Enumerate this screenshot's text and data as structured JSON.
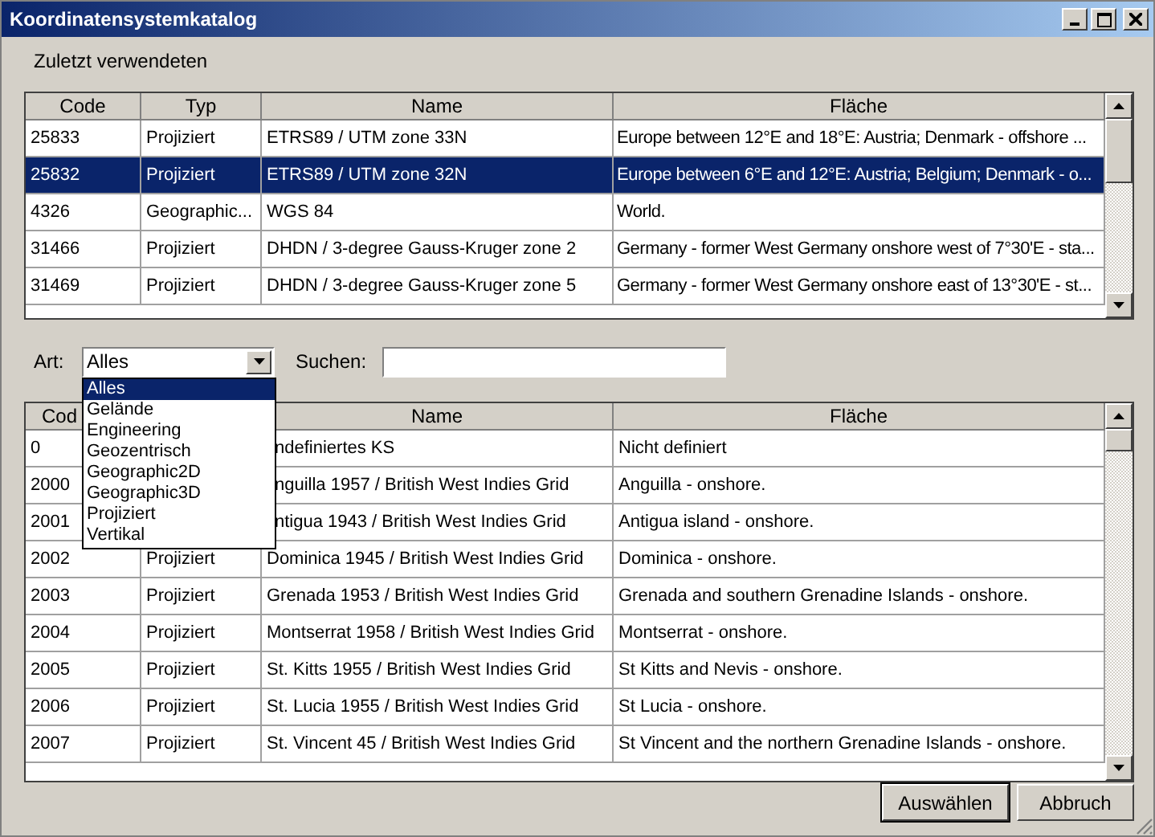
{
  "window": {
    "title": "Koordinatensystemkatalog"
  },
  "recent": {
    "label": "Zuletzt verwendeten",
    "columns": [
      "Code",
      "Typ",
      "Name",
      "Fläche"
    ],
    "rows": [
      {
        "code": "25833",
        "typ": "Projiziert",
        "name": "ETRS89 / UTM zone 33N",
        "flaeche": "Europe between 12°E and 18°E: Austria; Denmark - offshore ...",
        "selected": false
      },
      {
        "code": "25832",
        "typ": "Projiziert",
        "name": "ETRS89 / UTM zone 32N",
        "flaeche": "Europe between 6°E and 12°E: Austria; Belgium; Denmark - o...",
        "selected": true
      },
      {
        "code": "4326",
        "typ": "Geographic...",
        "name": "WGS 84",
        "flaeche": "World.",
        "selected": false
      },
      {
        "code": "31466",
        "typ": "Projiziert",
        "name": "DHDN / 3-degree Gauss-Kruger zone 2",
        "flaeche": "Germany - former West Germany onshore west of 7°30'E - sta...",
        "selected": false
      },
      {
        "code": "31469",
        "typ": "Projiziert",
        "name": "DHDN / 3-degree Gauss-Kruger zone 5",
        "flaeche": "Germany - former West Germany onshore east of 13°30'E - st...",
        "selected": false
      }
    ]
  },
  "filter": {
    "art_label": "Art:",
    "art_value": "Alles",
    "search_label": "Suchen:",
    "options": [
      {
        "label": "Alles",
        "selected": true
      },
      {
        "label": "Gelände",
        "selected": false
      },
      {
        "label": "Engineering",
        "selected": false
      },
      {
        "label": "Geozentrisch",
        "selected": false
      },
      {
        "label": "Geographic2D",
        "selected": false
      },
      {
        "label": "Geographic3D",
        "selected": false
      },
      {
        "label": "Projiziert",
        "selected": false
      },
      {
        "label": "Vertikal",
        "selected": false
      }
    ]
  },
  "catalog": {
    "columns": [
      "Cod",
      "Name",
      "Fläche"
    ],
    "rows": [
      {
        "code": "0",
        "name": "ndefiniertes KS",
        "flaeche": "Nicht definiert"
      },
      {
        "code": "2000",
        "name": "nguilla 1957 / British West Indies Grid",
        "flaeche": "Anguilla - onshore."
      },
      {
        "code": "2001",
        "name": "ntigua 1943 / British West Indies Grid",
        "flaeche": "Antigua island - onshore."
      },
      {
        "code": "2002",
        "typ": "Projiziert",
        "name": "Dominica 1945 / British West Indies Grid",
        "flaeche": "Dominica - onshore."
      },
      {
        "code": "2003",
        "typ": "Projiziert",
        "name": "Grenada 1953 / British West Indies Grid",
        "flaeche": "Grenada and southern Grenadine Islands - onshore."
      },
      {
        "code": "2004",
        "typ": "Projiziert",
        "name": "Montserrat 1958 / British West Indies Grid",
        "flaeche": "Montserrat - onshore."
      },
      {
        "code": "2005",
        "typ": "Projiziert",
        "name": "St. Kitts 1955 / British West Indies Grid",
        "flaeche": "St Kitts and Nevis - onshore."
      },
      {
        "code": "2006",
        "typ": "Projiziert",
        "name": "St. Lucia 1955 / British West Indies Grid",
        "flaeche": "St Lucia - onshore."
      },
      {
        "code": "2007",
        "typ": "Projiziert",
        "name": "St. Vincent 45 / British West Indies Grid",
        "flaeche": "St Vincent and the northern Grenadine Islands - onshore."
      }
    ]
  },
  "buttons": [
    {
      "label": "Auswählen",
      "default": true
    },
    {
      "label": "Abbruch",
      "default": false
    }
  ]
}
